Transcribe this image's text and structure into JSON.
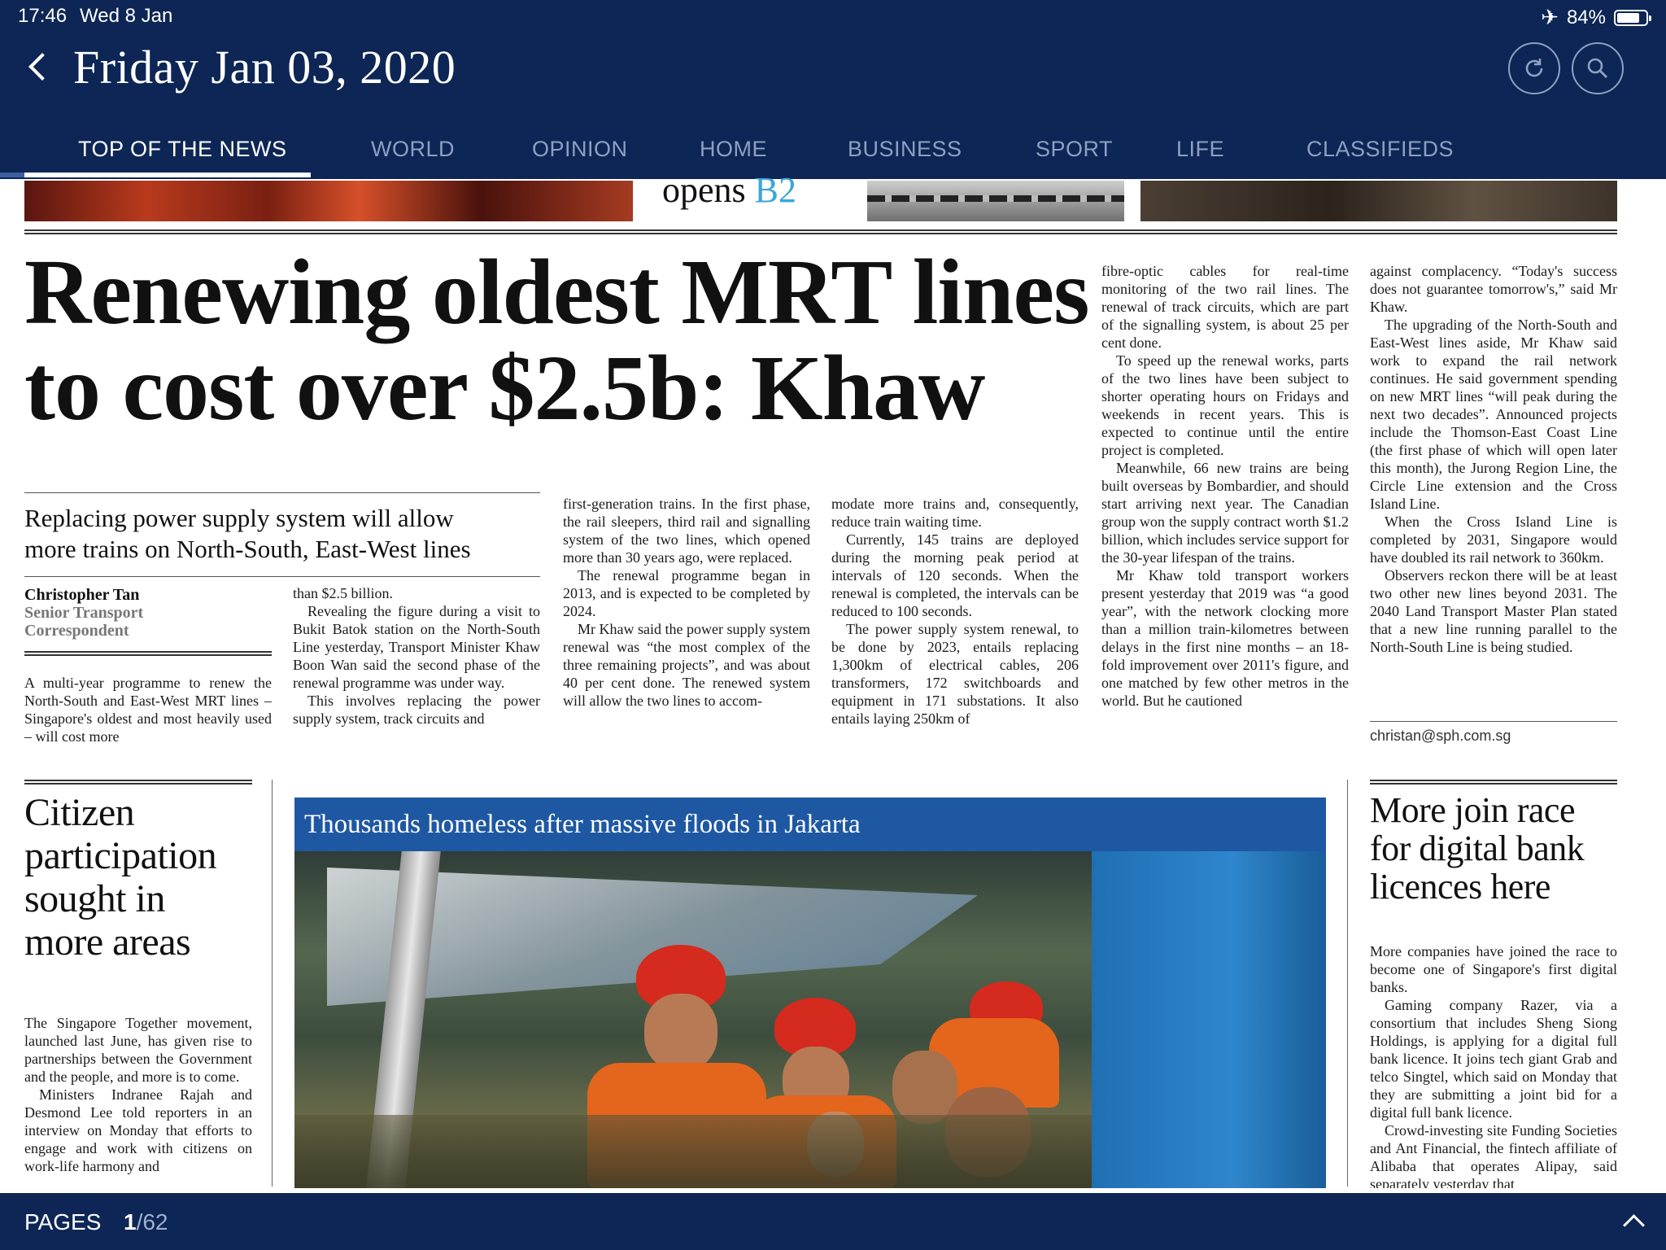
{
  "status": {
    "time": "17:46",
    "date": "Wed 8 Jan",
    "battery": "84%",
    "battery_level": 0.84
  },
  "header": {
    "title": "Friday Jan 03, 2020"
  },
  "tabs": [
    {
      "label": "TOP OF THE NEWS"
    },
    {
      "label": "WORLD"
    },
    {
      "label": "OPINION"
    },
    {
      "label": "HOME"
    },
    {
      "label": "BUSINESS"
    },
    {
      "label": "SPORT"
    },
    {
      "label": "LIFE"
    },
    {
      "label": "CLASSIFIEDS"
    }
  ],
  "teaser": {
    "word": "opens",
    "page": "B2"
  },
  "main_story": {
    "headline_line1": "Renewing oldest MRT lines",
    "headline_line2": "to cost over $2.5b: Khaw",
    "subhead_line1": "Replacing power supply system will allow",
    "subhead_line2": "more trains on North-South, East-West lines",
    "author": "Christopher Tan",
    "role_line1": "Senior Transport",
    "role_line2": "Correspondent",
    "col1": [
      "A multi-year programme to renew the North-South and East-West MRT lines – Singapore's oldest and most heavily used – will cost more"
    ],
    "col2": [
      "than $2.5 billion.",
      "Revealing the figure during a visit to Bukit Batok station on the North-South Line yesterday, Transport Minister Khaw Boon Wan said the second phase of the renewal programme was under way.",
      "This involves replacing the power supply system, track circuits and"
    ],
    "col3": [
      "first-generation trains. In the first phase, the rail sleepers, third rail and signalling system of the two lines, which opened more than 30 years ago, were replaced.",
      "The renewal programme began in 2013, and is expected to be completed by 2024.",
      "Mr Khaw said the power supply system renewal was “the most complex of the three remaining projects”, and was about 40 per cent done. The renewed system will allow the two lines to accom-"
    ],
    "col4": [
      "modate more trains and, consequently, reduce train waiting time.",
      "Currently, 145 trains are deployed during the morning peak period at intervals of 120 seconds. When the renewal is completed, the intervals can be reduced to 100 seconds.",
      "The power supply system renewal, to be done by 2023, entails replacing 1,300km of electrical cables, 206 transformers, 172 switchboards and equipment in 171 substations. It also entails laying 250km of"
    ],
    "col5": [
      "fibre-optic cables for real-time monitoring of the two rail lines. The renewal of track circuits, which are part of the signalling system, is about 25 per cent done.",
      "To speed up the renewal works, parts of the two lines have been subject to shorter operating hours on Fridays and weekends in recent years. This is expected to continue until the entire project is completed.",
      "Meanwhile, 66 new trains are being built overseas by Bombardier, and should start arriving next year. The Canadian group won the supply contract worth $1.2 billion, which includes service support for the 30-year lifespan of the trains.",
      "Mr Khaw told transport workers present yesterday that 2019 was “a good year”, with the network clocking more than a million train-kilometres between delays in the first nine months – an 18-fold improvement over 2011's figure, and one matched by few other metros in the world. But he cautioned"
    ],
    "col6": [
      "against complacency. “Today's success does not guarantee tomorrow's,” said Mr Khaw.",
      "The upgrading of the North-South and East-West lines aside, Mr Khaw said work to expand the rail network continues. He said government spending on new MRT lines “will peak during the next two decades”. Announced projects include the Thomson-East Coast Line (the first phase of which will open later this month), the Jurong Region Line, the Circle Line extension and the Cross Island Line.",
      "When the Cross Island Line is completed by 2031, Singapore would have doubled its rail network to 360km.",
      "Observers reckon there will be at least two other new lines beyond 2031. The 2040 Land Transport Master Plan stated that a new line running parallel to the North-South Line is being studied."
    ],
    "email": "christan@sph.com.sg"
  },
  "left_story": {
    "headline_l1": "Citizen",
    "headline_l2": "participation",
    "headline_l3": "sought in",
    "headline_l4": "more areas",
    "body": [
      "The Singapore Together movement, launched last June, has given rise to partnerships between the Government and the people, and more is to come.",
      "Ministers Indranee Rajah and Desmond Lee told reporters in an interview on Monday that efforts to engage and work with citizens on work-life harmony and"
    ]
  },
  "photo_story": {
    "banner": "Thousands homeless after massive floods in Jakarta"
  },
  "right_story": {
    "headline_l1": "More join race",
    "headline_l2": "for digital bank",
    "headline_l3": "licences here",
    "body": [
      "More companies have joined the race to become one of Singapore's first digital banks.",
      "Gaming company Razer, via a consortium that includes Sheng Siong Holdings, is applying for a digital full bank licence. It joins tech giant Grab and telco Singtel, which said on Monday that they are submitting a joint bid for a digital full bank licence.",
      "Crowd-investing site Funding Societies and Ant Financial, the fintech affiliate of Alibaba that operates Alipay, said separately yesterday that"
    ]
  },
  "footer": {
    "label": "PAGES",
    "current": "1",
    "total": "/62"
  }
}
